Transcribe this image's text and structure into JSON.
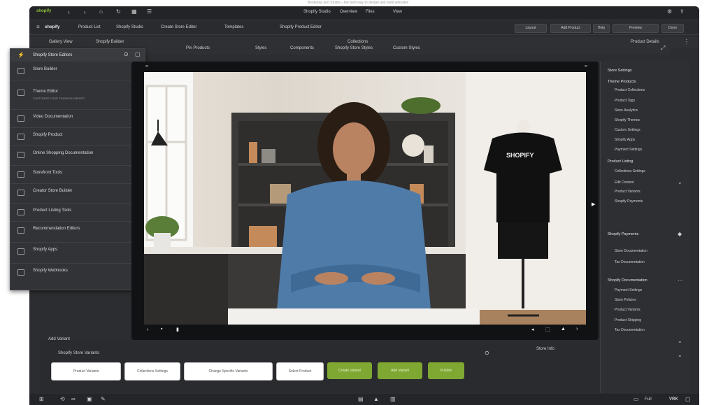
{
  "top_caption": "Bootstrap and Studio – the best way to design and build websites",
  "titlebar": {
    "logo": "shopify",
    "center_title": "Shopify Studio",
    "center_tabs": [
      "Overview",
      "Files",
      "View"
    ]
  },
  "toolbar": {
    "app_name": "shopify",
    "menus": [
      "Product List",
      "Shopify Studio",
      "Create Store Editor",
      "Templates",
      "Shopify Product Editor"
    ],
    "right_buttons": [
      "Layout",
      "Add Product",
      "Help",
      "Preview",
      "Done"
    ]
  },
  "subtoolbar": {
    "items": [
      "Gallery View",
      "Shopify Builder",
      "Collections"
    ],
    "right_text": "Product Details"
  },
  "content_tabs": [
    "Pin Products",
    "Styles",
    "Components",
    "Shopify Store Styles",
    "Custom Styles"
  ],
  "left_panel": {
    "title": "Shopify Store Editors",
    "items": [
      {
        "label": "Store Builder",
        "sub": ""
      },
      {
        "label": "Theme Editor",
        "sub": "CUSTOMIZE YOUR THEME ELEMENTS"
      },
      {
        "label": "Video Documentation",
        "sub": ""
      },
      {
        "label": "Shopify Product",
        "sub": ""
      },
      {
        "label": "Online Shopping Documentation",
        "sub": ""
      },
      {
        "label": "Storefront Tools",
        "sub": ""
      },
      {
        "label": "Creator Store Builder",
        "sub": ""
      },
      {
        "label": "Product Listing Tools",
        "sub": ""
      },
      {
        "label": "Recommendation Editors",
        "sub": ""
      },
      {
        "label": "Shopify Apps",
        "sub": ""
      },
      {
        "label": "Shopify Webhooks",
        "sub": ""
      }
    ]
  },
  "preview": {
    "shirt_text": "SHOPIFY"
  },
  "right_panel": {
    "heading": "Store Settings",
    "section1": "Theme Products",
    "items1": [
      "Product Collections",
      "Product Tags",
      "Store Analytics",
      "Shopify Themes",
      "Custom Settings",
      "Shopify Apps",
      "Payment Settings"
    ],
    "section2": "Product Listing",
    "items2": [
      "Collections Settings",
      "Edit Content",
      "Product Variants",
      "Shopify Payments"
    ],
    "section3": "Shopify Payments",
    "items3": [
      "Store Documentation",
      "Tax Documentation"
    ],
    "section4": "Shopify Documentation",
    "items4": [
      "Payment Settings",
      "Store Policies",
      "Product Variants",
      "Product Shipping",
      "Tax Documentation"
    ]
  },
  "bottom": {
    "label": "Add Variant",
    "section": "Shopify Store Variants",
    "buttons": [
      "Product Variants",
      "Collections Settings",
      "Change Specific Variants",
      "Select Product"
    ],
    "green_buttons": [
      "Create Variant",
      "Add Variant",
      "Publish"
    ],
    "right_label": "Store Info"
  },
  "statusbar": {
    "right": [
      "Full",
      "VRK"
    ]
  }
}
